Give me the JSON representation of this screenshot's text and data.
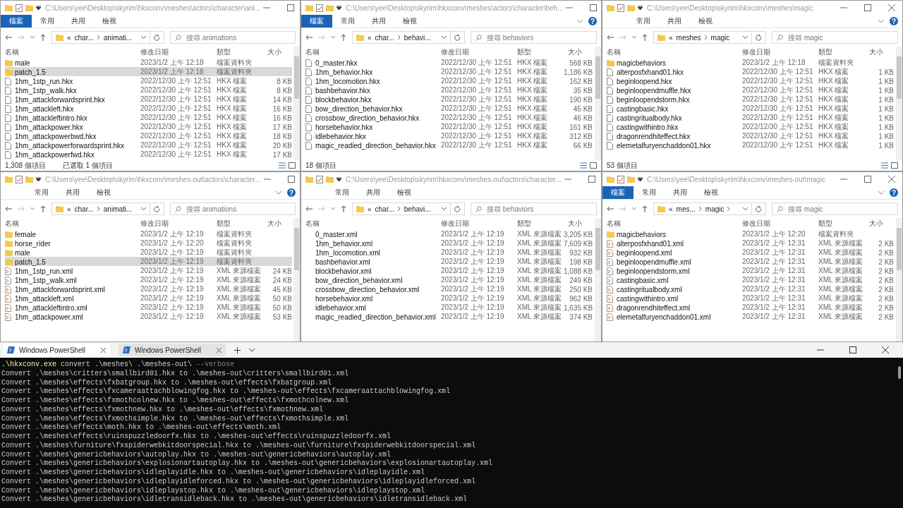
{
  "windows": [
    {
      "title": "C:\\Users\\yee\\Desktop\\skyrim\\hkxconv\\meshes\\actors\\character\\ani...",
      "ribbon": [
        {
          "label": "檔案",
          "kind": "file"
        },
        {
          "label": "常用",
          "kind": "tab"
        },
        {
          "label": "共用",
          "kind": "tab"
        },
        {
          "label": "檢視",
          "kind": "tab"
        }
      ],
      "breadcrumb": {
        "lead": "«",
        "parts": [
          "char...",
          "animati..."
        ]
      },
      "search": {
        "placeholder": "搜尋 animations"
      },
      "columns": [
        "名稱",
        "修改日期",
        "類型",
        "大小"
      ],
      "rows": [
        {
          "kind": "folder",
          "name": "male",
          "date": "2023/1/2 上午 12:18",
          "type": "檔案資料夾",
          "size": "",
          "selected": false
        },
        {
          "kind": "folder",
          "name": "patch_1.5",
          "date": "2023/1/2 上午 12:18",
          "type": "檔案資料夾",
          "size": "",
          "selected": true
        },
        {
          "kind": "file",
          "name": "1hm_1stp_run.hkx",
          "date": "2022/12/30 上午 12:51",
          "type": "HKX 檔案",
          "size": "8 KB",
          "selected": false
        },
        {
          "kind": "file",
          "name": "1hm_1stp_walk.hkx",
          "date": "2022/12/30 上午 12:51",
          "type": "HKX 檔案",
          "size": "8 KB",
          "selected": false
        },
        {
          "kind": "file",
          "name": "1hm_attackforwardsprint.hkx",
          "date": "2022/12/30 上午 12:51",
          "type": "HKX 檔案",
          "size": "14 KB",
          "selected": false
        },
        {
          "kind": "file",
          "name": "1hm_attackleft.hkx",
          "date": "2022/12/30 上午 12:51",
          "type": "HKX 檔案",
          "size": "16 KB",
          "selected": false
        },
        {
          "kind": "file",
          "name": "1hm_attackleftintro.hkx",
          "date": "2022/12/30 上午 12:51",
          "type": "HKX 檔案",
          "size": "16 KB",
          "selected": false
        },
        {
          "kind": "file",
          "name": "1hm_attackpower.hkx",
          "date": "2022/12/30 上午 12:51",
          "type": "HKX 檔案",
          "size": "17 KB",
          "selected": false
        },
        {
          "kind": "file",
          "name": "1hm_attackpowerbwd.hkx",
          "date": "2022/12/30 上午 12:51",
          "type": "HKX 檔案",
          "size": "18 KB",
          "selected": false
        },
        {
          "kind": "file",
          "name": "1hm_attackpowerforwardsprint.hkx",
          "date": "2022/12/30 上午 12:51",
          "type": "HKX 檔案",
          "size": "20 KB",
          "selected": false
        },
        {
          "kind": "file",
          "name": "1hm_attackpowerfwd.hkx",
          "date": "2022/12/30 上午 12:51",
          "type": "HKX 檔案",
          "size": "17 KB",
          "selected": false
        }
      ],
      "status": [
        "1,308 個項目",
        "已選取 1 個項目"
      ]
    },
    {
      "title": "C:\\Users\\yee\\Desktop\\skyrim\\hkxconv\\meshes\\actors\\character\\beh...",
      "ribbon": [
        {
          "label": "檔案",
          "kind": "file"
        },
        {
          "label": "常用",
          "kind": "tab"
        },
        {
          "label": "共用",
          "kind": "tab"
        },
        {
          "label": "檢視",
          "kind": "tab"
        }
      ],
      "help": "?",
      "breadcrumb": {
        "lead": "«",
        "parts": [
          "char...",
          "behavi..."
        ]
      },
      "search": {
        "placeholder": "搜尋 behaviors"
      },
      "columns": [
        "名稱",
        "修改日期",
        "類型",
        "大小"
      ],
      "rows": [
        {
          "kind": "file",
          "name": "0_master.hkx",
          "date": "2022/12/30 上午 12:51",
          "type": "HKX 檔案",
          "size": "568 KB",
          "selected": false
        },
        {
          "kind": "file",
          "name": "1hm_behavior.hkx",
          "date": "2022/12/30 上午 12:51",
          "type": "HKX 檔案",
          "size": "1,186 KB",
          "selected": false
        },
        {
          "kind": "file",
          "name": "1hm_locomotion.hkx",
          "date": "2022/12/30 上午 12:51",
          "type": "HKX 檔案",
          "size": "162 KB",
          "selected": false
        },
        {
          "kind": "file",
          "name": "bashbehavior.hkx",
          "date": "2022/12/30 上午 12:51",
          "type": "HKX 檔案",
          "size": "35 KB",
          "selected": false
        },
        {
          "kind": "file",
          "name": "blockbehavior.hkx",
          "date": "2022/12/30 上午 12:51",
          "type": "HKX 檔案",
          "size": "190 KB",
          "selected": false
        },
        {
          "kind": "file",
          "name": "bow_direction_behavior.hkx",
          "date": "2022/12/30 上午 12:51",
          "type": "HKX 檔案",
          "size": "45 KB",
          "selected": false
        },
        {
          "kind": "file",
          "name": "crossbow_direction_behavior.hkx",
          "date": "2022/12/30 上午 12:51",
          "type": "HKX 檔案",
          "size": "46 KB",
          "selected": false
        },
        {
          "kind": "file",
          "name": "horsebehavior.hkx",
          "date": "2022/12/30 上午 12:51",
          "type": "HKX 檔案",
          "size": "161 KB",
          "selected": false
        },
        {
          "kind": "file",
          "name": "idlebehavior.hkx",
          "date": "2022/12/30 上午 12:51",
          "type": "HKX 檔案",
          "size": "312 KB",
          "selected": false
        },
        {
          "kind": "file",
          "name": "magic_readied_direction_behavior.hkx",
          "date": "2022/12/30 上午 12:51",
          "type": "HKX 檔案",
          "size": "66 KB",
          "selected": false
        }
      ],
      "status": [
        "18 個項目"
      ]
    },
    {
      "title": "C:\\Users\\yee\\Desktop\\skyrim\\hkxconv\\meshes\\magic",
      "ribbon": [
        {
          "label": "常用",
          "kind": "tab"
        },
        {
          "label": "共用",
          "kind": "tab"
        },
        {
          "label": "檢視",
          "kind": "tab"
        }
      ],
      "help": "?",
      "breadcrumb": {
        "lead": "«",
        "parts": [
          "meshes",
          "magic"
        ]
      },
      "search": {
        "placeholder": "搜尋 magic"
      },
      "columns": [
        "名稱",
        "修改日期",
        "類型",
        "大小"
      ],
      "rows": [
        {
          "kind": "folder",
          "name": "magicbehaviors",
          "date": "2023/1/2 上午 12:18",
          "type": "檔案資料夾",
          "size": "",
          "selected": false
        },
        {
          "kind": "file",
          "name": "alterposfxhand01.hkx",
          "date": "2022/12/30 上午 12:51",
          "type": "HKX 檔案",
          "size": "1 KB",
          "selected": false
        },
        {
          "kind": "file",
          "name": "beginloopend.hkx",
          "date": "2022/12/30 上午 12:51",
          "type": "HKX 檔案",
          "size": "1 KB",
          "selected": false
        },
        {
          "kind": "file",
          "name": "beginloopendmuffle.hkx",
          "date": "2022/12/30 上午 12:51",
          "type": "HKX 檔案",
          "size": "1 KB",
          "selected": false
        },
        {
          "kind": "file",
          "name": "beginloopendstorm.hkx",
          "date": "2022/12/30 上午 12:51",
          "type": "HKX 檔案",
          "size": "1 KB",
          "selected": false
        },
        {
          "kind": "file",
          "name": "castingbasic.hkx",
          "date": "2022/12/30 上午 12:51",
          "type": "HKX 檔案",
          "size": "1 KB",
          "selected": false
        },
        {
          "kind": "file",
          "name": "castingritualbody.hkx",
          "date": "2022/12/30 上午 12:51",
          "type": "HKX 檔案",
          "size": "1 KB",
          "selected": false
        },
        {
          "kind": "file",
          "name": "castingwithintro.hkx",
          "date": "2022/12/30 上午 12:51",
          "type": "HKX 檔案",
          "size": "1 KB",
          "selected": false
        },
        {
          "kind": "file",
          "name": "dragonrendhiteffect.hkx",
          "date": "2022/12/30 上午 12:51",
          "type": "HKX 檔案",
          "size": "1 KB",
          "selected": false
        },
        {
          "kind": "file",
          "name": "elemetalfuryenchaddon01.hkx",
          "date": "2022/12/30 上午 12:51",
          "type": "HKX 檔案",
          "size": "1 KB",
          "selected": false
        }
      ],
      "status": [
        "53 個項目"
      ]
    },
    {
      "title": "C:\\Users\\yee\\Desktop\\skyrim\\hkxconv\\meshes-out\\actors\\character...",
      "ribbon": [
        {
          "label": "常用",
          "kind": "tab"
        },
        {
          "label": "共用",
          "kind": "tab"
        },
        {
          "label": "檢視",
          "kind": "tab"
        }
      ],
      "help": "?",
      "breadcrumb": {
        "lead": "«",
        "parts": [
          "char...",
          "animati..."
        ]
      },
      "search": {
        "placeholder": "搜尋 animations"
      },
      "columns": [
        "名稱",
        "修改日期",
        "類型",
        "大小"
      ],
      "rows": [
        {
          "kind": "folder",
          "name": "female",
          "date": "2023/1/2 上午 12:19",
          "type": "檔案資料夾",
          "size": "",
          "selected": false
        },
        {
          "kind": "folder",
          "name": "horse_rider",
          "date": "2023/1/2 上午 12:20",
          "type": "檔案資料夾",
          "size": "",
          "selected": false
        },
        {
          "kind": "folder",
          "name": "male",
          "date": "2023/1/2 上午 12:19",
          "type": "檔案資料夾",
          "size": "",
          "selected": false
        },
        {
          "kind": "folder",
          "name": "patch_1.5",
          "date": "2023/1/2 上午 12:19",
          "type": "檔案資料夾",
          "size": "",
          "selected": true
        },
        {
          "kind": "xml",
          "name": "1hm_1stp_run.xml",
          "date": "2023/1/2 上午 12:19",
          "type": "XML 來源檔案",
          "size": "24 KB",
          "selected": false
        },
        {
          "kind": "xml",
          "name": "1hm_1stp_walk.xml",
          "date": "2023/1/2 上午 12:19",
          "type": "XML 來源檔案",
          "size": "24 KB",
          "selected": false
        },
        {
          "kind": "xml",
          "name": "1hm_attackforwardsprint.xml",
          "date": "2023/1/2 上午 12:19",
          "type": "XML 來源檔案",
          "size": "45 KB",
          "selected": false
        },
        {
          "kind": "xml",
          "name": "1hm_attackleft.xml",
          "date": "2023/1/2 上午 12:19",
          "type": "XML 來源檔案",
          "size": "50 KB",
          "selected": false
        },
        {
          "kind": "xml",
          "name": "1hm_attackleftintro.xml",
          "date": "2023/1/2 上午 12:19",
          "type": "XML 來源檔案",
          "size": "50 KB",
          "selected": false
        },
        {
          "kind": "xml",
          "name": "1hm_attackpower.xml",
          "date": "2023/1/2 上午 12:19",
          "type": "XML 來源檔案",
          "size": "53 KB",
          "selected": false
        }
      ]
    },
    {
      "title": "C:\\Users\\yee\\Desktop\\skyrim\\hkxconv\\meshes-out\\actors\\character...",
      "ribbon": [
        {
          "label": "常用",
          "kind": "tab"
        },
        {
          "label": "共用",
          "kind": "tab"
        },
        {
          "label": "檢視",
          "kind": "tab"
        }
      ],
      "breadcrumb": {
        "lead": "«",
        "parts": [
          "char...",
          "behavi..."
        ]
      },
      "search": {
        "placeholder": "搜尋 behaviors"
      },
      "columns": [
        "名稱",
        "修改日期",
        "類型",
        "大小"
      ],
      "rows": [
        {
          "kind": "plain",
          "name": "0_master.xml",
          "date": "2023/1/2 上午 12:19",
          "type": "XML 來源檔案",
          "size": "3,205 KB",
          "selected": false
        },
        {
          "kind": "plain",
          "name": "1hm_behavior.xml",
          "date": "2023/1/2 上午 12:19",
          "type": "XML 來源檔案",
          "size": "7,609 KB",
          "selected": false
        },
        {
          "kind": "plain",
          "name": "1hm_locomotion.xml",
          "date": "2023/1/2 上午 12:19",
          "type": "XML 來源檔案",
          "size": "932 KB",
          "selected": false
        },
        {
          "kind": "plain",
          "name": "bashbehavior.xml",
          "date": "2023/1/2 上午 12:19",
          "type": "XML 來源檔案",
          "size": "198 KB",
          "selected": false
        },
        {
          "kind": "plain",
          "name": "blockbehavior.xml",
          "date": "2023/1/2 上午 12:19",
          "type": "XML 來源檔案",
          "size": "1,088 KB",
          "selected": false
        },
        {
          "kind": "plain",
          "name": "bow_direction_behavior.xml",
          "date": "2023/1/2 上午 12:19",
          "type": "XML 來源檔案",
          "size": "249 KB",
          "selected": false
        },
        {
          "kind": "plain",
          "name": "crossbow_direction_behavior.xml",
          "date": "2023/1/2 上午 12:19",
          "type": "XML 來源檔案",
          "size": "250 KB",
          "selected": false
        },
        {
          "kind": "plain",
          "name": "horsebehavior.xml",
          "date": "2023/1/2 上午 12:19",
          "type": "XML 來源檔案",
          "size": "962 KB",
          "selected": false
        },
        {
          "kind": "plain",
          "name": "idlebehavior.xml",
          "date": "2023/1/2 上午 12:19",
          "type": "XML 來源檔案",
          "size": "1,635 KB",
          "selected": false
        },
        {
          "kind": "plain",
          "name": "magic_readied_direction_behavior.xml",
          "date": "2023/1/2 上午 12:19",
          "type": "XML 來源檔案",
          "size": "374 KB",
          "selected": false
        }
      ]
    },
    {
      "title": "C:\\Users\\yee\\Desktop\\skyrim\\hkxconv\\meshes-out\\magic",
      "ribbon": [
        {
          "label": "檔案",
          "kind": "file"
        },
        {
          "label": "常用",
          "kind": "tab"
        },
        {
          "label": "共用",
          "kind": "tab"
        },
        {
          "label": "檢視",
          "kind": "tab"
        }
      ],
      "help": "?",
      "breadcrumb": {
        "lead": "«",
        "parts": [
          "mes...",
          "magic"
        ],
        "trailing_chevron": true
      },
      "search": {
        "placeholder": "搜尋 magic"
      },
      "columns": [
        "名稱",
        "修改日期",
        "類型",
        "大小"
      ],
      "rows": [
        {
          "kind": "folder",
          "name": "magicbehaviors",
          "date": "2023/1/2 上午 12:20",
          "type": "檔案資料夾",
          "size": "",
          "selected": false
        },
        {
          "kind": "xml",
          "name": "alterposfxhand01.xml",
          "date": "2023/1/2 上午 12:31",
          "type": "XML 來源檔案",
          "size": "2 KB",
          "selected": false
        },
        {
          "kind": "xml",
          "name": "beginloopend.xml",
          "date": "2023/1/2 上午 12:31",
          "type": "XML 來源檔案",
          "size": "2 KB",
          "selected": false
        },
        {
          "kind": "xml",
          "name": "beginloopendmuffle.xml",
          "date": "2023/1/2 上午 12:31",
          "type": "XML 來源檔案",
          "size": "2 KB",
          "selected": false
        },
        {
          "kind": "xml",
          "name": "beginloopendstorm.xml",
          "date": "2023/1/2 上午 12:31",
          "type": "XML 來源檔案",
          "size": "2 KB",
          "selected": false
        },
        {
          "kind": "xml",
          "name": "castingbasic.xml",
          "date": "2023/1/2 上午 12:31",
          "type": "XML 來源檔案",
          "size": "2 KB",
          "selected": false
        },
        {
          "kind": "xml",
          "name": "castingritualbody.xml",
          "date": "2023/1/2 上午 12:31",
          "type": "XML 來源檔案",
          "size": "2 KB",
          "selected": false
        },
        {
          "kind": "xml",
          "name": "castingwithintro.xml",
          "date": "2023/1/2 上午 12:31",
          "type": "XML 來源檔案",
          "size": "2 KB",
          "selected": false
        },
        {
          "kind": "xml",
          "name": "dragonrendhiteffect.xml",
          "date": "2023/1/2 上午 12:31",
          "type": "XML 來源檔案",
          "size": "2 KB",
          "selected": false
        },
        {
          "kind": "xml",
          "name": "elemetalfuryenchaddon01.xml",
          "date": "2023/1/2 上午 12:31",
          "type": "XML 來源檔案",
          "size": "2 KB",
          "selected": false
        }
      ]
    }
  ],
  "terminal": {
    "tabs": [
      {
        "label": "Windows PowerShell",
        "selected": true
      },
      {
        "label": "Windows PowerShell",
        "selected": false
      }
    ],
    "command": [
      {
        "kind": "exe",
        "text": ".\\hkxconv.exe"
      },
      {
        "kind": "arg",
        "text": "convert .\\meshes\\ .\\meshes-out\\"
      },
      {
        "kind": "flag",
        "text": "--verbose"
      }
    ],
    "lines": [
      "Convert .\\meshes\\critters\\smallbird01.hkx to .\\meshes-out\\critters\\smallbird01.xml",
      "Convert .\\meshes\\effects\\fxbatgroup.hkx to .\\meshes-out\\effects\\fxbatgroup.xml",
      "Convert .\\meshes\\effects\\fxcameraattachblowingfog.hkx to .\\meshes-out\\effects\\fxcameraattachblowingfog.xml",
      "Convert .\\meshes\\effects\\fxmothcolnew.hkx to .\\meshes-out\\effects\\fxmothcolnew.xml",
      "Convert .\\meshes\\effects\\fxmothnew.hkx to .\\meshes-out\\effects\\fxmothnew.xml",
      "Convert .\\meshes\\effects\\fxmothsimple.hkx to .\\meshes-out\\effects\\fxmothsimple.xml",
      "Convert .\\meshes\\effects\\moth.hkx to .\\meshes-out\\effects\\moth.xml",
      "Convert .\\meshes\\effects\\ruinspuzzledoorfx.hkx to .\\meshes-out\\effects\\ruinspuzzledoorfx.xml",
      "Convert .\\meshes\\furniture\\fxspiderwebkitdoorspecial.hkx to .\\meshes-out\\furniture\\fxspiderwebkitdoorspecial.xml",
      "Convert .\\meshes\\genericbehaviors\\autoplay.hkx to .\\meshes-out\\genericbehaviors\\autoplay.xml",
      "Convert .\\meshes\\genericbehaviors\\explosionartautoplay.hkx to .\\meshes-out\\genericbehaviors\\explosionartautoplay.xml",
      "Convert .\\meshes\\genericbehaviors\\idleplayidle.hkx to .\\meshes-out\\genericbehaviors\\idleplayidle.xml",
      "Convert .\\meshes\\genericbehaviors\\idleplayidleforced.hkx to .\\meshes-out\\genericbehaviors\\idleplayidleforced.xml",
      "Convert .\\meshes\\genericbehaviors\\idleplaystop.hkx to .\\meshes-out\\genericbehaviors\\idleplaystop.xml",
      "Convert .\\meshes\\genericbehaviors\\idletransidleback.hkx to .\\meshes-out\\genericbehaviors\\idletransidleback.xml"
    ]
  }
}
